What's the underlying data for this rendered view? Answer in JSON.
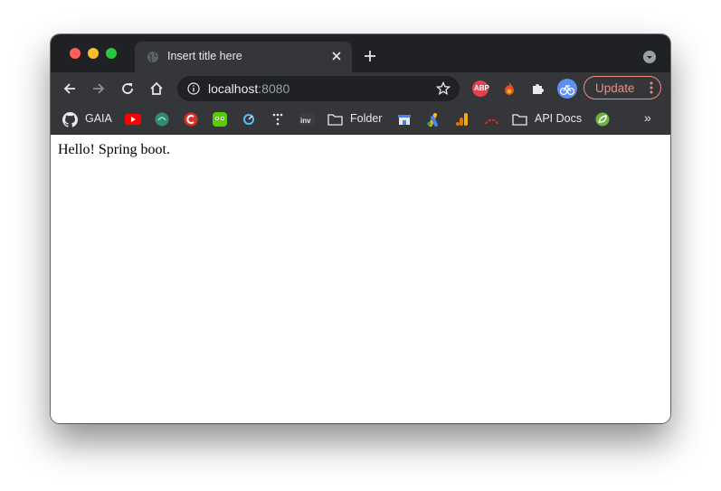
{
  "tab": {
    "title": "Insert title here"
  },
  "omnibox": {
    "host": "localhost",
    "port": ":8080"
  },
  "toolbar": {
    "update_label": "Update"
  },
  "extensions": [
    {
      "name": "adblock-plus-icon",
      "text": "ABP",
      "color": "#e4414f"
    },
    {
      "name": "fire-extension-icon",
      "color": "#ea4c2c"
    },
    {
      "name": "puzzle-icon"
    },
    {
      "name": "profile-avatar-icon",
      "color": "#5d8ef2"
    }
  ],
  "bookmarks": {
    "gaia": "GAIA",
    "folder1": "Folder",
    "folder2": "API Docs",
    "overflow": "»"
  },
  "colors": {
    "titlebar": "#202124",
    "toolbar": "#35363a",
    "accent_update": "#f28b82"
  },
  "page": {
    "body_text": "Hello! Spring boot."
  }
}
